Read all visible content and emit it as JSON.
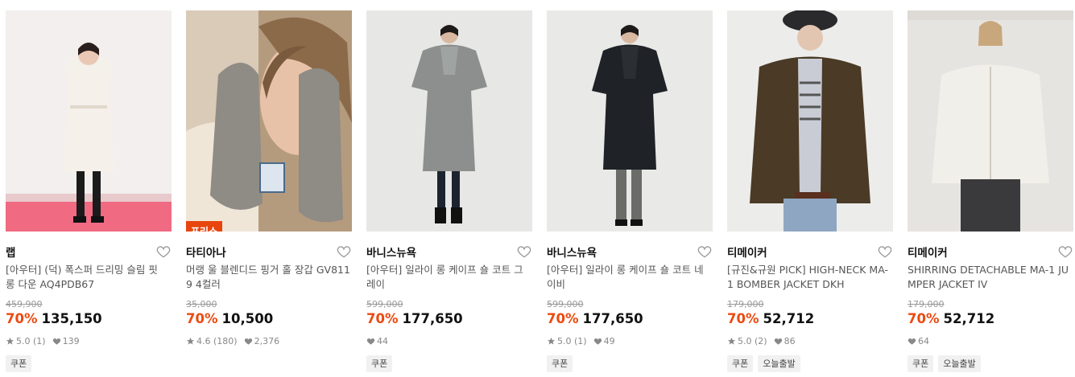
{
  "colors": {
    "accent": "#ec4a10",
    "badge_bg": "#e8450c",
    "tag_bg": "#f1f1f1"
  },
  "products": [
    {
      "brand": "랩",
      "name": "[아우터] (덕) 폭스퍼 드리밍 슬림 핏 롱 다운 AQ4PDB67",
      "original_price": "459,900",
      "discount": "70%",
      "price": "135,150",
      "rating": "5.0",
      "reviews": "(1)",
      "likes": "139",
      "tags": [
        "쿠폰"
      ],
      "badge": "",
      "image": "model-white-long-down"
    },
    {
      "brand": "타티아나",
      "name": "머랭 울 블렌디드 핑거 홀 장갑 GV8119 4컬러",
      "original_price": "35,000",
      "discount": "70%",
      "price": "10,500",
      "rating": "4.6",
      "reviews": "(180)",
      "likes": "2,376",
      "tags": [],
      "badge": "프리쇼",
      "image": "model-grey-gloves"
    },
    {
      "brand": "바니스뉴욕",
      "name": "[아우터] 일라이 롱 케이프 숄 코트 그레이",
      "original_price": "599,000",
      "discount": "70%",
      "price": "177,650",
      "rating": "",
      "reviews": "",
      "likes": "44",
      "tags": [
        "쿠폰"
      ],
      "badge": "",
      "image": "model-grey-cape-coat"
    },
    {
      "brand": "바니스뉴욕",
      "name": "[아우터] 일라이 롱 케이프 숄 코트 네이비",
      "original_price": "599,000",
      "discount": "70%",
      "price": "177,650",
      "rating": "5.0",
      "reviews": "(1)",
      "likes": "49",
      "tags": [
        "쿠폰"
      ],
      "badge": "",
      "image": "model-navy-cape-coat"
    },
    {
      "brand": "티메이커",
      "name": "[규진&규원 PICK] HIGH-NECK MA-1 BOMBER JACKET DKH",
      "original_price": "179,000",
      "discount": "70%",
      "price": "52,712",
      "rating": "5.0",
      "reviews": "(2)",
      "likes": "86",
      "tags": [
        "쿠폰",
        "오늘출발"
      ],
      "badge": "",
      "image": "model-khaki-bomber"
    },
    {
      "brand": "티메이커",
      "name": "SHIRRING DETACHABLE MA-1 JUMPER JACKET IV",
      "original_price": "179,000",
      "discount": "70%",
      "price": "52,712",
      "rating": "",
      "reviews": "",
      "likes": "64",
      "tags": [
        "쿠폰",
        "오늘출발"
      ],
      "badge": "",
      "image": "model-ivory-jumper"
    }
  ]
}
